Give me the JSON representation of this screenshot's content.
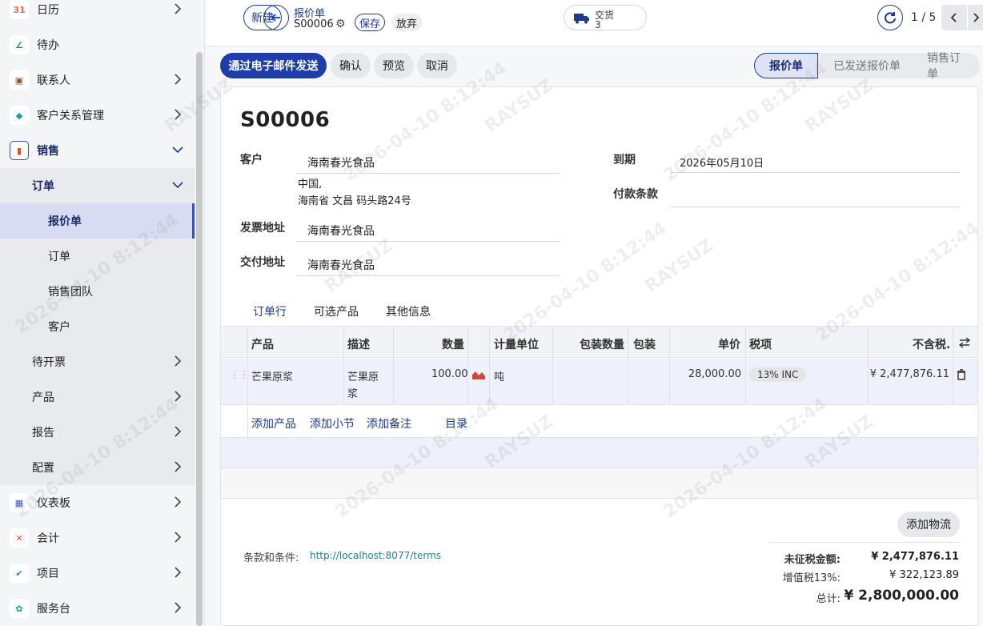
{
  "sidebar": {
    "items": [
      {
        "label": "日历",
        "icon": "calendar-icon",
        "glyph": "31",
        "color": "#e06b4f"
      },
      {
        "label": "待办",
        "icon": "todo-icon",
        "glyph": "∠",
        "color": "#1a8f5a"
      },
      {
        "label": "联系人",
        "icon": "contacts-icon",
        "glyph": "▣",
        "color": "#8a5a2b"
      },
      {
        "label": "客户关系管理",
        "icon": "crm-icon",
        "glyph": "◆",
        "color": "#1aa1a1"
      },
      {
        "label": "销售",
        "icon": "sales-icon",
        "glyph": "▮",
        "color": "#e0502b"
      },
      {
        "label": "订单"
      },
      {
        "label": "报价单"
      },
      {
        "label": "订单"
      },
      {
        "label": "销售团队"
      },
      {
        "label": "客户"
      },
      {
        "label": "待开票"
      },
      {
        "label": "产品"
      },
      {
        "label": "报告"
      },
      {
        "label": "配置"
      },
      {
        "label": "仪表板",
        "icon": "dashboard-icon",
        "glyph": "▦",
        "color": "#3a5ad0"
      },
      {
        "label": "会计",
        "icon": "accounting-icon",
        "glyph": "✕",
        "color": "#e0502b"
      },
      {
        "label": "项目",
        "icon": "project-icon",
        "glyph": "✔",
        "color": "#3a7ad0"
      },
      {
        "label": "服务台",
        "icon": "helpdesk-icon",
        "glyph": "✿",
        "color": "#1aa17a"
      }
    ]
  },
  "topbar": {
    "new_label": "新建",
    "breadcrumb_parent": "报价单",
    "record_name": "S00006",
    "save_label": "保存",
    "discard_label": "放弃",
    "delivery_label": "交货",
    "delivery_count": "3",
    "pager": "1 / 5"
  },
  "actions": {
    "send_email": "通过电子邮件发送",
    "confirm": "确认",
    "preview": "预览",
    "cancel": "取消"
  },
  "stages": [
    "报价单",
    "已发送报价单",
    "销售订单"
  ],
  "form": {
    "title": "S00006",
    "customer_label": "客户",
    "customer": "海南春光食品",
    "address_line1": "中国,",
    "address_line2": "海南省 文昌 码头路24号",
    "invoice_addr_label": "发票地址",
    "invoice_addr": "海南春光食品",
    "delivery_addr_label": "交付地址",
    "delivery_addr": "海南春光食品",
    "due_label": "到期",
    "due_date": "2026年05月10日",
    "payment_terms_label": "付款条款"
  },
  "tabs": [
    "订单行",
    "可选产品",
    "其他信息"
  ],
  "table": {
    "headers": {
      "product": "产品",
      "description": "描述",
      "quantity": "数量",
      "uom": "计量单位",
      "pkg_qty": "包装数量",
      "pkg": "包装",
      "price": "单价",
      "taxes": "税项",
      "subtotal": "不含税."
    },
    "rows": [
      {
        "product": "芒果原浆",
        "description_1": "芒果原",
        "description_2": "浆",
        "quantity": "100.00",
        "uom": "吨",
        "price": "28,000.00",
        "tax": "13% INC",
        "subtotal": "¥ 2,477,876.11"
      }
    ],
    "add_product": "添加产品",
    "add_section": "添加小节",
    "add_note": "添加备注",
    "catalog": "目录"
  },
  "footer": {
    "add_shipping": "添加物流",
    "terms_label": "条款和条件:",
    "terms_link": "http://localhost:8077/terms",
    "untaxed_label": "未征税金额:",
    "untaxed_value": "¥ 2,477,876.11",
    "vat_label": "增值税13%:",
    "vat_value": "¥ 322,123.89",
    "total_label": "总计:",
    "total_value": "¥ 2,800,000.00"
  },
  "watermark": {
    "brand": "RAYSUZ",
    "timestamp": "2026-04-10 8:12:44"
  }
}
